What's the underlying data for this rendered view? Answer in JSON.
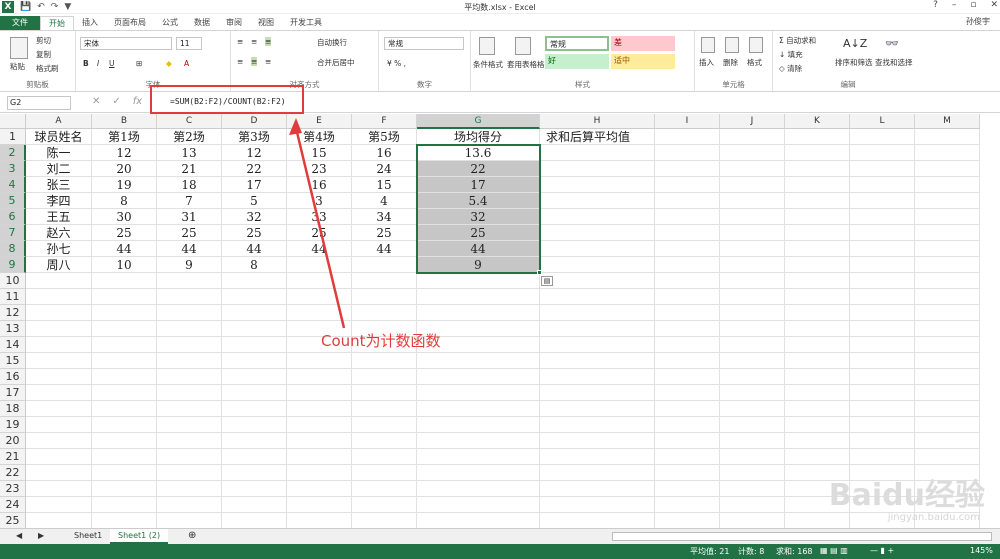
{
  "app": {
    "title": "平均数.xlsx - Excel",
    "user": "孙俊宇"
  },
  "ribbon_tabs": [
    "文件",
    "开始",
    "插入",
    "页面布局",
    "公式",
    "数据",
    "审阅",
    "视图",
    "开发工具"
  ],
  "ribbon": {
    "clipboard": {
      "paste": "粘贴",
      "cut": "剪切",
      "copy": "复制",
      "format_painter": "格式刷",
      "label": "剪贴板"
    },
    "font": {
      "name": "宋体",
      "size": "11",
      "label": "字体"
    },
    "align": {
      "wrap": "自动换行",
      "merge": "合并后居中",
      "label": "对齐方式"
    },
    "number": {
      "format": "常规",
      "label": "数字"
    },
    "styles": {
      "cond": "条件格式",
      "table": "套用表格格式",
      "normal": "常规",
      "bad": "差",
      "good": "好",
      "neutral": "适中",
      "label": "样式"
    },
    "cells": {
      "insert": "插入",
      "delete": "删除",
      "format": "格式",
      "label": "单元格"
    },
    "editing": {
      "autosum": "自动求和",
      "fill": "填充",
      "clear": "清除",
      "sort": "排序和筛选",
      "find": "查找和选择",
      "label": "编辑"
    }
  },
  "formula_bar": {
    "name_box": "G2",
    "formula": "=SUM(B2:F2)/COUNT(B2:F2)"
  },
  "columns": [
    "A",
    "B",
    "C",
    "D",
    "E",
    "F",
    "G",
    "H",
    "I",
    "J",
    "K",
    "L",
    "M"
  ],
  "rows": [
    [
      "球员姓名",
      "第1场",
      "第2场",
      "第3场",
      "第4场",
      "第5场",
      "场均得分",
      "求和后算平均值"
    ],
    [
      "陈一",
      "12",
      "13",
      "12",
      "15",
      "16",
      "13.6",
      ""
    ],
    [
      "刘二",
      "20",
      "21",
      "22",
      "23",
      "24",
      "22",
      ""
    ],
    [
      "张三",
      "19",
      "18",
      "17",
      "16",
      "15",
      "17",
      ""
    ],
    [
      "李四",
      "8",
      "7",
      "5",
      "3",
      "4",
      "5.4",
      ""
    ],
    [
      "王五",
      "30",
      "31",
      "32",
      "33",
      "34",
      "32",
      ""
    ],
    [
      "赵六",
      "25",
      "25",
      "25",
      "25",
      "25",
      "25",
      ""
    ],
    [
      "孙七",
      "44",
      "44",
      "44",
      "44",
      "44",
      "44",
      ""
    ],
    [
      "周八",
      "10",
      "9",
      "8",
      "",
      "",
      "9",
      ""
    ]
  ],
  "row_count": 26,
  "annotation": "Count为计数函数",
  "sheets": [
    "Sheet1",
    "Sheet1 (2)"
  ],
  "status": {
    "avg": "平均值: 21",
    "count": "计数: 8",
    "sum": "求和: 168",
    "zoom": "145%"
  },
  "watermark": "Baidu经验",
  "watermark_url": "jingyan.baidu.com"
}
